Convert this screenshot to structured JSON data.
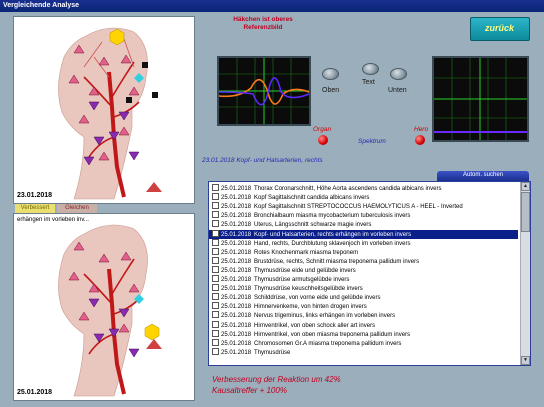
{
  "window": {
    "title": "Vergleichende Analyse"
  },
  "top_panel": {
    "date": "23.01.2018"
  },
  "bottom_panel": {
    "date": "25.01.2018",
    "label": "erhängen im vorleben inv..."
  },
  "tabs": {
    "left": "Verbessert",
    "right": "Gleichen"
  },
  "reference": {
    "line1": "Häkchen ist oberes",
    "line2": "Referenzbild"
  },
  "back_button": {
    "label": "zurück"
  },
  "knobs": {
    "top": "Text",
    "left": "Oben",
    "right": "Unten"
  },
  "indicators": {
    "organ": "Organ",
    "spectrum": "Spektrum",
    "hero": "Hero"
  },
  "selected_item_caption": "23.01.2018 Kopf- und Halsarterien, rechts",
  "search_button": {
    "label": "Autom. suchen"
  },
  "list": {
    "items": [
      {
        "date": "25.01.2018",
        "text": "Thorax Coronarschnitt, Höhe Aorta ascendens  candida albicans invers",
        "selected": false
      },
      {
        "date": "25.01.2018",
        "text": "Kopf Sagittalschnitt  candida albicans invers",
        "selected": false
      },
      {
        "date": "25.01.2018",
        "text": "Kopf Sagittalschnitt  STREPTOCOCCUS HAEMOLYTICUS A  - HEEL - Inverted",
        "selected": false
      },
      {
        "date": "25.01.2018",
        "text": "Bronchialbaum  miasma mycobacterium tuberculosis invers",
        "selected": false
      },
      {
        "date": "25.01.2018",
        "text": "Uterus, Längsschnitt  schwarze magie invers",
        "selected": false
      },
      {
        "date": "25.01.2018",
        "text": "Kopf- und Halsarterien, rechts  erhängen im vorleben invers",
        "selected": true
      },
      {
        "date": "25.01.2018",
        "text": "Hand, rechts, Durchblutung  sklavenjoch im vorleben invers",
        "selected": false
      },
      {
        "date": "25.01.2018",
        "text": "Rotes Knochenmark  miasma treponem",
        "selected": false
      },
      {
        "date": "25.01.2018",
        "text": "Brustdrüse, rechts, Schnitt  miasma treponema pallidum invers",
        "selected": false
      },
      {
        "date": "25.01.2018",
        "text": "Thymusdrüse  eide und gelübde invers",
        "selected": false
      },
      {
        "date": "25.01.2018",
        "text": "Thymusdrüse  armutsgelübde invers",
        "selected": false
      },
      {
        "date": "25.01.2018",
        "text": "Thymusdrüse  keuschheitsgelübde invers",
        "selected": false
      },
      {
        "date": "25.01.2018",
        "text": "Schilddrüse, von vorne  eide und gelübde invers",
        "selected": false
      },
      {
        "date": "25.01.2018",
        "text": "Himnervenkeme, von hinten  drogen invers",
        "selected": false
      },
      {
        "date": "25.01.2018",
        "text": "Nervus trigeminus, links  erhängen im vorleben invers",
        "selected": false
      },
      {
        "date": "25.01.2018",
        "text": "Hirnventrikel, von oben  schock aller art invers",
        "selected": false
      },
      {
        "date": "25.01.2018",
        "text": "Hirnventrikel, von oben  miasma treponema pallidum invers",
        "selected": false
      },
      {
        "date": "25.01.2018",
        "text": "Chromosomen Gr.A  miasma treponema pallidum invers",
        "selected": false
      },
      {
        "date": "25.01.2018",
        "text": "Thymusdrüse",
        "selected": false
      }
    ]
  },
  "summary": {
    "line1": "Verbesserung der Reaktion um 42%",
    "line2": "Kausaltreffer + 100%"
  },
  "colors": {
    "accent_blue": "#0a1f8a",
    "red_text": "#c00020",
    "background": "#9aaebb"
  }
}
